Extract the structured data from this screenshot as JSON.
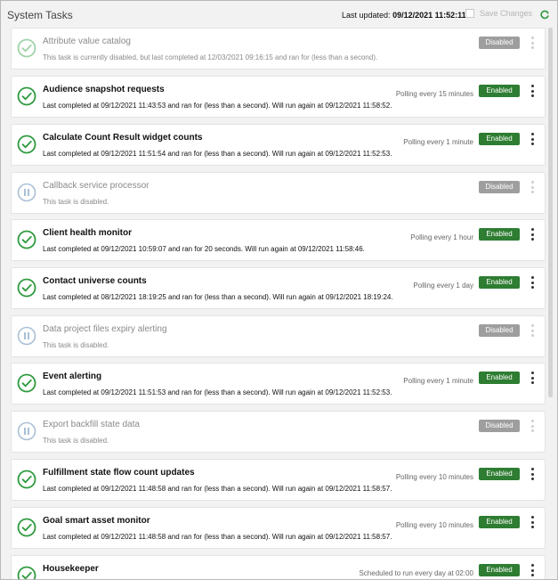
{
  "header": {
    "title": "System Tasks",
    "updated_label": "Last updated:",
    "updated_value": "09/12/2021 11:52:11",
    "save_label": "Save Changes"
  },
  "colors": {
    "enabled": "#2e7d32",
    "disabled": "#9e9e9e",
    "check": "#2e9a3e"
  },
  "tasks": [
    {
      "name": "Attribute value catalog",
      "desc": "This task is currently disabled, but last completed at 12/03/2021 09:16:15 and ran for (less than a second).",
      "poll": "",
      "status": "Disabled",
      "state": "off",
      "icon": "check-icon-faded"
    },
    {
      "name": "Audience snapshot requests",
      "desc": "Last completed at 09/12/2021 11:43:53 and ran for (less than a second). Will run again at 09/12/2021 11:58:52.",
      "poll": "Polling every 15 minutes",
      "status": "Enabled",
      "state": "on",
      "icon": "check-icon"
    },
    {
      "name": "Calculate Count Result widget counts",
      "desc": "Last completed at 09/12/2021 11:51:54 and ran for (less than a second). Will run again at 09/12/2021 11:52:53.",
      "poll": "Polling every 1 minute",
      "status": "Enabled",
      "state": "on",
      "icon": "check-icon"
    },
    {
      "name": "Callback service processor",
      "desc": "This task is disabled.",
      "poll": "",
      "status": "Disabled",
      "state": "off",
      "icon": "pause-icon"
    },
    {
      "name": "Client health monitor",
      "desc": "Last completed at 09/12/2021 10:59:07 and ran for 20 seconds. Will run again at 09/12/2021 11:58:46.",
      "poll": "Polling every 1 hour",
      "status": "Enabled",
      "state": "on",
      "icon": "check-icon"
    },
    {
      "name": "Contact universe counts",
      "desc": "Last completed at 08/12/2021 18:19:25 and ran for (less than a second). Will run again at 09/12/2021 18:19:24.",
      "poll": "Polling every 1 day",
      "status": "Enabled",
      "state": "on",
      "icon": "check-icon"
    },
    {
      "name": "Data project files expiry alerting",
      "desc": "This task is disabled.",
      "poll": "",
      "status": "Disabled",
      "state": "off",
      "icon": "pause-icon"
    },
    {
      "name": "Event alerting",
      "desc": "Last completed at 09/12/2021 11:51:53 and ran for (less than a second). Will run again at 09/12/2021 11:52:53.",
      "poll": "Polling every 1 minute",
      "status": "Enabled",
      "state": "on",
      "icon": "check-icon"
    },
    {
      "name": "Export backfill state data",
      "desc": "This task is disabled.",
      "poll": "",
      "status": "Disabled",
      "state": "off",
      "icon": "pause-icon"
    },
    {
      "name": "Fulfillment state flow count updates",
      "desc": "Last completed at 09/12/2021 11:48:58 and ran for (less than a second). Will run again at 09/12/2021 11:58:57.",
      "poll": "Polling every 10 minutes",
      "status": "Enabled",
      "state": "on",
      "icon": "check-icon"
    },
    {
      "name": "Goal smart asset monitor",
      "desc": "Last completed at 09/12/2021 11:48:58 and ran for (less than a second). Will run again at 09/12/2021 11:58:57.",
      "poll": "Polling every 10 minutes",
      "status": "Enabled",
      "state": "on",
      "icon": "check-icon"
    },
    {
      "name": "Housekeeper",
      "desc": "",
      "poll": "Scheduled to run every day at 02:00",
      "status": "Enabled",
      "state": "on",
      "icon": "check-icon"
    }
  ]
}
